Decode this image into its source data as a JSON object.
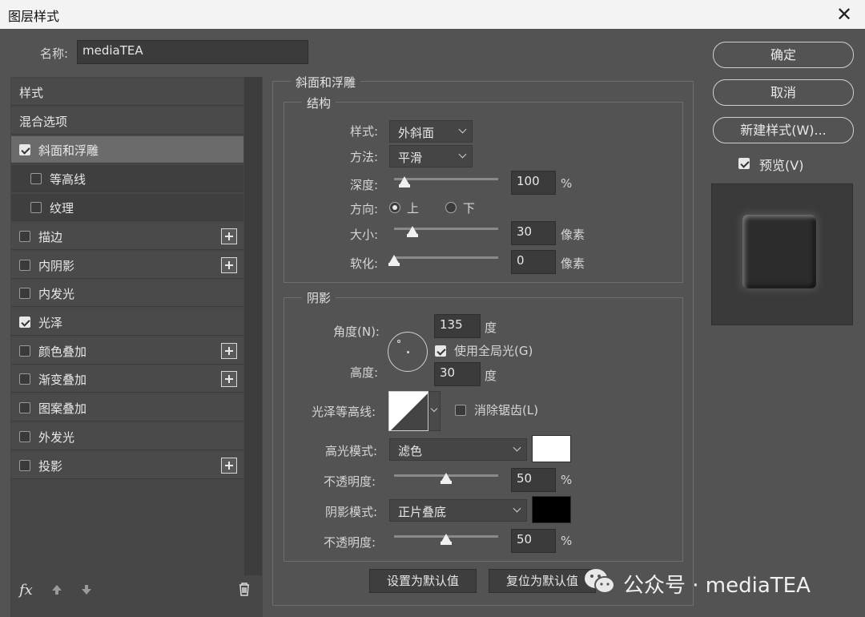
{
  "window": {
    "title": "图层样式",
    "close": "✕"
  },
  "name": {
    "label": "名称:",
    "value": "mediaTEA"
  },
  "left": {
    "items": [
      {
        "label": "样式",
        "checkbox": null,
        "plus": false
      },
      {
        "label": "混合选项",
        "checkbox": null,
        "plus": false
      },
      {
        "label": "斜面和浮雕",
        "checkbox": true,
        "plus": false
      },
      {
        "label": "等高线",
        "checkbox": false,
        "plus": false
      },
      {
        "label": "纹理",
        "checkbox": false,
        "plus": false
      },
      {
        "label": "描边",
        "checkbox": false,
        "plus": true
      },
      {
        "label": "内阴影",
        "checkbox": false,
        "plus": true
      },
      {
        "label": "内发光",
        "checkbox": false,
        "plus": false
      },
      {
        "label": "光泽",
        "checkbox": true,
        "plus": false
      },
      {
        "label": "颜色叠加",
        "checkbox": false,
        "plus": true
      },
      {
        "label": "渐变叠加",
        "checkbox": false,
        "plus": true
      },
      {
        "label": "图案叠加",
        "checkbox": false,
        "plus": false
      },
      {
        "label": "外发光",
        "checkbox": false,
        "plus": false
      },
      {
        "label": "投影",
        "checkbox": false,
        "plus": true
      }
    ],
    "fx": "fx"
  },
  "bevel": {
    "title": "斜面和浮雕",
    "structure": {
      "title": "结构",
      "style_label": "样式:",
      "style_value": "外斜面",
      "method_label": "方法:",
      "method_value": "平滑",
      "depth_label": "深度:",
      "depth_value": "100",
      "depth_unit": "%",
      "direction_label": "方向:",
      "up": "上",
      "down": "下",
      "size_label": "大小:",
      "size_value": "30",
      "size_unit": "像素",
      "soften_label": "软化:",
      "soften_value": "0",
      "soften_unit": "像素"
    },
    "shading": {
      "title": "阴影",
      "angle_label": "角度(N):",
      "angle_value": "135",
      "angle_unit": "度",
      "global_light": "使用全局光(G)",
      "altitude_label": "高度:",
      "altitude_value": "30",
      "altitude_unit": "度",
      "contour_label": "光泽等高线:",
      "anti_alias": "消除锯齿(L)",
      "highlight_label": "高光模式:",
      "highlight_value": "滤色",
      "highlight_color": "#ffffff",
      "hl_opacity_label": "不透明度:",
      "hl_opacity_value": "50",
      "hl_opacity_unit": "%",
      "shadow_label": "阴影模式:",
      "shadow_value": "正片叠底",
      "shadow_color": "#000000",
      "sh_opacity_label": "不透明度:",
      "sh_opacity_value": "50",
      "sh_opacity_unit": "%"
    },
    "set_default": "设置为默认值",
    "reset_default": "复位为默认值"
  },
  "right": {
    "ok": "确定",
    "cancel": "取消",
    "new_style": "新建样式(W)...",
    "preview_label": "预览(V)"
  },
  "watermark": {
    "text": "公众号 · mediaTEA"
  }
}
